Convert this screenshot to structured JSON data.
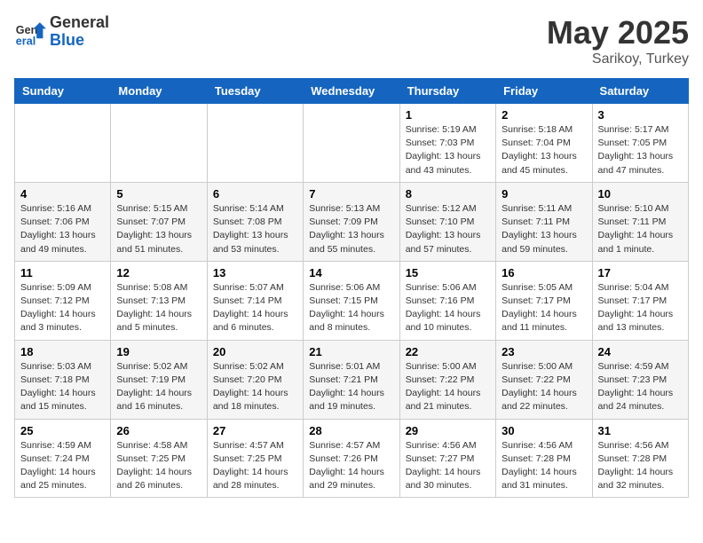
{
  "header": {
    "logo_general": "General",
    "logo_blue": "Blue",
    "month_title": "May 2025",
    "location": "Sarikoy, Turkey"
  },
  "weekdays": [
    "Sunday",
    "Monday",
    "Tuesday",
    "Wednesday",
    "Thursday",
    "Friday",
    "Saturday"
  ],
  "weeks": [
    [
      {
        "day": "",
        "info": ""
      },
      {
        "day": "",
        "info": ""
      },
      {
        "day": "",
        "info": ""
      },
      {
        "day": "",
        "info": ""
      },
      {
        "day": "1",
        "info": "Sunrise: 5:19 AM\nSunset: 7:03 PM\nDaylight: 13 hours\nand 43 minutes."
      },
      {
        "day": "2",
        "info": "Sunrise: 5:18 AM\nSunset: 7:04 PM\nDaylight: 13 hours\nand 45 minutes."
      },
      {
        "day": "3",
        "info": "Sunrise: 5:17 AM\nSunset: 7:05 PM\nDaylight: 13 hours\nand 47 minutes."
      }
    ],
    [
      {
        "day": "4",
        "info": "Sunrise: 5:16 AM\nSunset: 7:06 PM\nDaylight: 13 hours\nand 49 minutes."
      },
      {
        "day": "5",
        "info": "Sunrise: 5:15 AM\nSunset: 7:07 PM\nDaylight: 13 hours\nand 51 minutes."
      },
      {
        "day": "6",
        "info": "Sunrise: 5:14 AM\nSunset: 7:08 PM\nDaylight: 13 hours\nand 53 minutes."
      },
      {
        "day": "7",
        "info": "Sunrise: 5:13 AM\nSunset: 7:09 PM\nDaylight: 13 hours\nand 55 minutes."
      },
      {
        "day": "8",
        "info": "Sunrise: 5:12 AM\nSunset: 7:10 PM\nDaylight: 13 hours\nand 57 minutes."
      },
      {
        "day": "9",
        "info": "Sunrise: 5:11 AM\nSunset: 7:11 PM\nDaylight: 13 hours\nand 59 minutes."
      },
      {
        "day": "10",
        "info": "Sunrise: 5:10 AM\nSunset: 7:11 PM\nDaylight: 14 hours\nand 1 minute."
      }
    ],
    [
      {
        "day": "11",
        "info": "Sunrise: 5:09 AM\nSunset: 7:12 PM\nDaylight: 14 hours\nand 3 minutes."
      },
      {
        "day": "12",
        "info": "Sunrise: 5:08 AM\nSunset: 7:13 PM\nDaylight: 14 hours\nand 5 minutes."
      },
      {
        "day": "13",
        "info": "Sunrise: 5:07 AM\nSunset: 7:14 PM\nDaylight: 14 hours\nand 6 minutes."
      },
      {
        "day": "14",
        "info": "Sunrise: 5:06 AM\nSunset: 7:15 PM\nDaylight: 14 hours\nand 8 minutes."
      },
      {
        "day": "15",
        "info": "Sunrise: 5:06 AM\nSunset: 7:16 PM\nDaylight: 14 hours\nand 10 minutes."
      },
      {
        "day": "16",
        "info": "Sunrise: 5:05 AM\nSunset: 7:17 PM\nDaylight: 14 hours\nand 11 minutes."
      },
      {
        "day": "17",
        "info": "Sunrise: 5:04 AM\nSunset: 7:17 PM\nDaylight: 14 hours\nand 13 minutes."
      }
    ],
    [
      {
        "day": "18",
        "info": "Sunrise: 5:03 AM\nSunset: 7:18 PM\nDaylight: 14 hours\nand 15 minutes."
      },
      {
        "day": "19",
        "info": "Sunrise: 5:02 AM\nSunset: 7:19 PM\nDaylight: 14 hours\nand 16 minutes."
      },
      {
        "day": "20",
        "info": "Sunrise: 5:02 AM\nSunset: 7:20 PM\nDaylight: 14 hours\nand 18 minutes."
      },
      {
        "day": "21",
        "info": "Sunrise: 5:01 AM\nSunset: 7:21 PM\nDaylight: 14 hours\nand 19 minutes."
      },
      {
        "day": "22",
        "info": "Sunrise: 5:00 AM\nSunset: 7:22 PM\nDaylight: 14 hours\nand 21 minutes."
      },
      {
        "day": "23",
        "info": "Sunrise: 5:00 AM\nSunset: 7:22 PM\nDaylight: 14 hours\nand 22 minutes."
      },
      {
        "day": "24",
        "info": "Sunrise: 4:59 AM\nSunset: 7:23 PM\nDaylight: 14 hours\nand 24 minutes."
      }
    ],
    [
      {
        "day": "25",
        "info": "Sunrise: 4:59 AM\nSunset: 7:24 PM\nDaylight: 14 hours\nand 25 minutes."
      },
      {
        "day": "26",
        "info": "Sunrise: 4:58 AM\nSunset: 7:25 PM\nDaylight: 14 hours\nand 26 minutes."
      },
      {
        "day": "27",
        "info": "Sunrise: 4:57 AM\nSunset: 7:25 PM\nDaylight: 14 hours\nand 28 minutes."
      },
      {
        "day": "28",
        "info": "Sunrise: 4:57 AM\nSunset: 7:26 PM\nDaylight: 14 hours\nand 29 minutes."
      },
      {
        "day": "29",
        "info": "Sunrise: 4:56 AM\nSunset: 7:27 PM\nDaylight: 14 hours\nand 30 minutes."
      },
      {
        "day": "30",
        "info": "Sunrise: 4:56 AM\nSunset: 7:28 PM\nDaylight: 14 hours\nand 31 minutes."
      },
      {
        "day": "31",
        "info": "Sunrise: 4:56 AM\nSunset: 7:28 PM\nDaylight: 14 hours\nand 32 minutes."
      }
    ]
  ]
}
